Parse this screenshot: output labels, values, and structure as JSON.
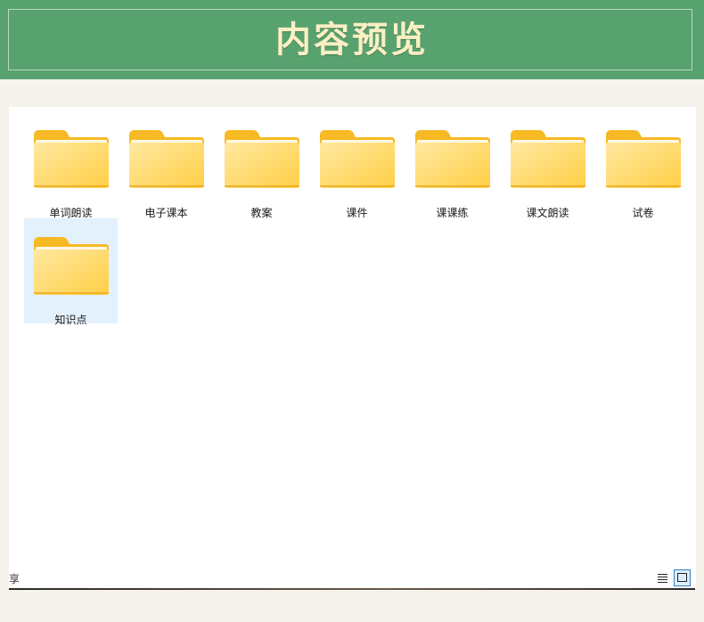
{
  "header": {
    "title": "内容预览"
  },
  "folders": [
    {
      "label": "单词朗读",
      "selected": false
    },
    {
      "label": "电子课本",
      "selected": false
    },
    {
      "label": "教案",
      "selected": false
    },
    {
      "label": "课件",
      "selected": false
    },
    {
      "label": "课课练",
      "selected": false
    },
    {
      "label": "课文朗读",
      "selected": false
    },
    {
      "label": "试卷",
      "selected": false
    },
    {
      "label": "知识点",
      "selected": true
    }
  ],
  "status_bar": {
    "left_text": "享",
    "view_buttons": [
      {
        "name": "details-view",
        "icon": "list-icon",
        "active": false
      },
      {
        "name": "large-icons-view",
        "icon": "tile-icon",
        "active": true
      }
    ]
  },
  "colors": {
    "banner": "#58a26f",
    "title": "#fbefc4",
    "folder_front": "#ffd24d",
    "folder_back": "#f7b924",
    "selection": "#e3f1fd"
  }
}
